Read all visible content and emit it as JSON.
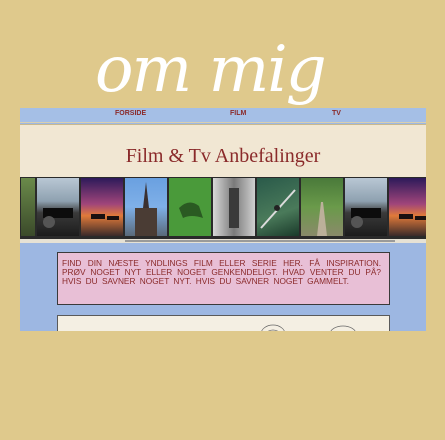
{
  "page": {
    "heading": "om mig"
  },
  "nav": {
    "items": [
      "FORSIDE",
      "FILM",
      "TV"
    ]
  },
  "header": {
    "title": "Film & Tv Anbefalinger"
  },
  "filmstrip": {
    "images": [
      "car-dashboard-image",
      "sunset-cars-image",
      "cathedral-image",
      "dinosaur-toy-image",
      "train-interior-image",
      "skater-image",
      "road-image",
      "car-dashboard-image",
      "sunset-cars-image"
    ]
  },
  "intro": {
    "text": "FIND DIN NÆSTE YNDLINGS FILM ELLER SERIE HER. FÅ INSPIRATION. PRØV NOGET NYT ELLER NOGET GENKENDELIGT. HVAD VENTER DU PÅ? HVIS DU SAVNER NOGET NYT. HVIS DU SAVNER NOGET GAMMELT."
  },
  "colors": {
    "accent": "#8a2a2a",
    "page_bg": "#dfc98c",
    "panel_bg": "#9db7e2",
    "intro_bg": "#e8bfd6"
  }
}
